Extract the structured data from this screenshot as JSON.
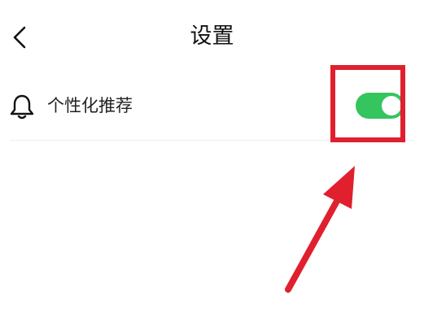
{
  "header": {
    "title": "设置",
    "back_icon": "chevron-left-icon"
  },
  "setting": {
    "icon": "bell-icon",
    "label": "个性化推荐",
    "toggle_state": "on",
    "toggle_color": "#34c55e"
  },
  "annotation": {
    "highlight_color": "#e0202e",
    "arrow_color": "#e0202e"
  }
}
